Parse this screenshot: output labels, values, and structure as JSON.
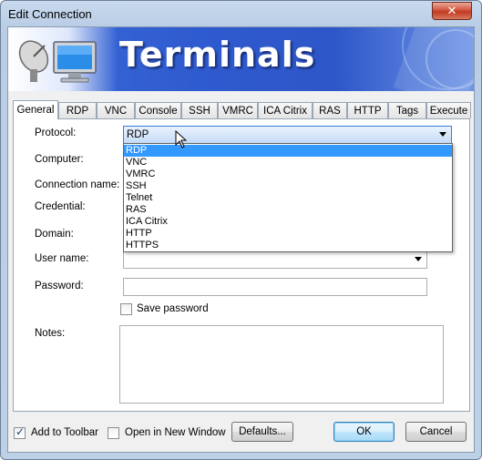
{
  "window": {
    "title": "Edit Connection",
    "close_glyph": "✕"
  },
  "banner": {
    "title": "Terminals",
    "icon": "terminal-computer-icon"
  },
  "tabs": [
    {
      "label": "General",
      "active": true
    },
    {
      "label": "RDP",
      "active": false
    },
    {
      "label": "VNC",
      "active": false
    },
    {
      "label": "Console",
      "active": false
    },
    {
      "label": "SSH",
      "active": false
    },
    {
      "label": "VMRC",
      "active": false
    },
    {
      "label": "ICA Citrix",
      "active": false
    },
    {
      "label": "RAS",
      "active": false
    },
    {
      "label": "HTTP",
      "active": false
    },
    {
      "label": "Tags",
      "active": false
    },
    {
      "label": "Execute",
      "active": false
    }
  ],
  "form": {
    "protocol_label": "Protocol:",
    "protocol_value": "RDP",
    "computer_label": "Computer:",
    "connection_name_label": "Connection name:",
    "credential_label": "Credential:",
    "domain_label": "Domain:",
    "username_label": "User name:",
    "password_label": "Password:",
    "save_password_label": "Save password",
    "save_password_checked": false,
    "notes_label": "Notes:"
  },
  "protocol_options": [
    "RDP",
    "VNC",
    "VMRC",
    "SSH",
    "Telnet",
    "RAS",
    "ICA Citrix",
    "HTTP",
    "HTTPS"
  ],
  "protocol_selected": "RDP",
  "footer": {
    "add_to_toolbar_label": "Add to Toolbar",
    "add_to_toolbar_checked": true,
    "open_new_window_label": "Open in New Window",
    "open_new_window_checked": false,
    "defaults_label": "Defaults...",
    "ok_label": "OK",
    "cancel_label": "Cancel"
  },
  "colors": {
    "selection": "#3399ff",
    "banner_blue": "#2f5bd0",
    "close_red": "#c13a22"
  }
}
